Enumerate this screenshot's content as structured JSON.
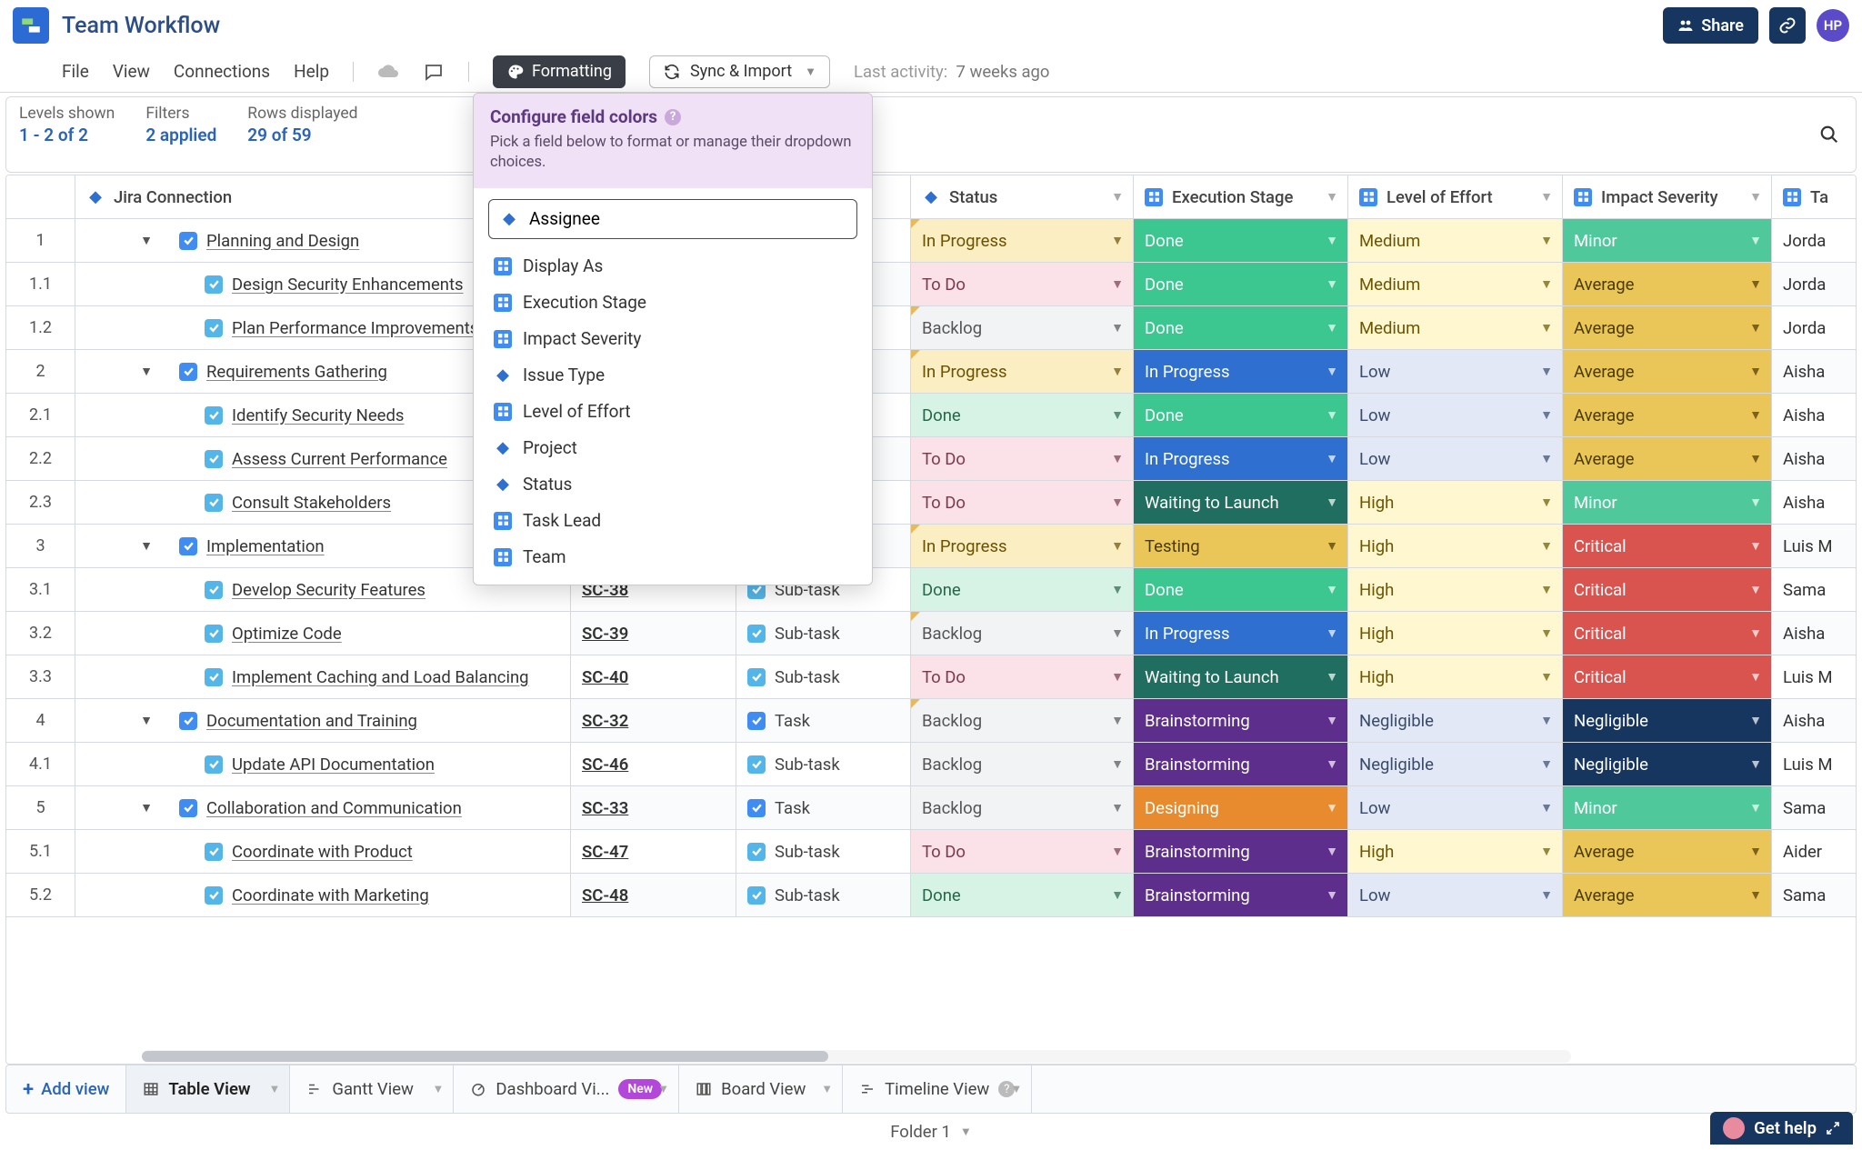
{
  "header": {
    "title": "Team Workflow",
    "share": "Share",
    "avatar": "HP"
  },
  "menubar": {
    "file": "File",
    "view": "View",
    "connections": "Connections",
    "help": "Help",
    "formatting": "Formatting",
    "sync": "Sync & Import",
    "activity_label": "Last activity:",
    "activity_value": "7 weeks ago"
  },
  "panel": {
    "levels_label": "Levels shown",
    "levels_value": "1 - 2 of 2",
    "filters_label": "Filters",
    "filters_value": "2 applied",
    "rows_label": "Rows displayed",
    "rows_value": "29 of 59"
  },
  "dropdown": {
    "title": "Configure field colors",
    "help": "Pick a field below to format or manage their dropdown choices.",
    "search": "Assignee",
    "items": [
      {
        "icon": "board",
        "label": "Display As"
      },
      {
        "icon": "board",
        "label": "Execution Stage"
      },
      {
        "icon": "board",
        "label": "Impact Severity"
      },
      {
        "icon": "diamond",
        "label": "Issue Type"
      },
      {
        "icon": "board",
        "label": "Level of Effort"
      },
      {
        "icon": "diamond",
        "label": "Project"
      },
      {
        "icon": "diamond",
        "label": "Status"
      },
      {
        "icon": "board",
        "label": "Task Lead"
      },
      {
        "icon": "board",
        "label": "Team"
      }
    ]
  },
  "columns": [
    {
      "key": "num",
      "label": "",
      "icon": "",
      "w": "w-num"
    },
    {
      "key": "name",
      "label": "Jira Connection",
      "icon": "jira",
      "w": "w-name"
    },
    {
      "key": "id",
      "label": "",
      "icon": "",
      "w": "w-id"
    },
    {
      "key": "type",
      "label": "",
      "icon": "",
      "w": "w-type"
    },
    {
      "key": "status",
      "label": "Status",
      "icon": "diamond",
      "w": "w-status",
      "caret": true
    },
    {
      "key": "stage",
      "label": "Execution Stage",
      "icon": "board",
      "w": "w-stage",
      "caret": true
    },
    {
      "key": "effort",
      "label": "Level of Effort",
      "icon": "board",
      "w": "w-effort",
      "caret": true
    },
    {
      "key": "impact",
      "label": "Impact Severity",
      "icon": "board",
      "w": "w-impact",
      "caret": true
    },
    {
      "key": "lead",
      "label": "Ta",
      "icon": "board",
      "w": "w-lead"
    }
  ],
  "status_colors": {
    "In Progress": "c-inprog-light",
    "To Do": "c-todo",
    "Backlog": "c-backlog",
    "Done": "c-done-light"
  },
  "stage_colors": {
    "Done": "c-done",
    "In Progress": "c-inprog",
    "Waiting to Launch": "c-waiting",
    "Testing": "c-testing",
    "Brainstorming": "c-brainstorm",
    "Designing": "c-designing"
  },
  "effort_colors": {
    "Medium": "c-med",
    "Low": "c-low",
    "High": "c-high",
    "Negligible": "c-negl"
  },
  "impact_colors": {
    "Minor": "c-minor",
    "Average": "c-average",
    "Critical": "c-critical",
    "Negligible": "c-negl-dark"
  },
  "rows": [
    {
      "num": "1",
      "depth": 0,
      "expand": true,
      "chk": "task",
      "name": "Planning and Design",
      "id": "",
      "type": "",
      "status": "In Progress",
      "stage": "Done",
      "effort": "Medium",
      "impact": "Minor",
      "lead": "Jorda",
      "corner": true
    },
    {
      "num": "1.1",
      "depth": 1,
      "chk": "sub",
      "name": "Design Security Enhancements",
      "id": "",
      "type": "",
      "status": "To Do",
      "stage": "Done",
      "effort": "Medium",
      "impact": "Average",
      "lead": "Jorda"
    },
    {
      "num": "1.2",
      "depth": 1,
      "chk": "sub",
      "name": "Plan Performance Improvements",
      "id": "",
      "type": "",
      "status": "Backlog",
      "stage": "Done",
      "effort": "Medium",
      "impact": "Average",
      "lead": "Jorda",
      "corner": true
    },
    {
      "num": "2",
      "depth": 0,
      "expand": true,
      "chk": "task",
      "name": "Requirements Gathering",
      "id": "",
      "type": "",
      "status": "In Progress",
      "stage": "In Progress",
      "effort": "Low",
      "impact": "Average",
      "lead": "Aisha",
      "corner": true
    },
    {
      "num": "2.1",
      "depth": 1,
      "chk": "sub",
      "name": "Identify Security Needs",
      "id": "",
      "type": "",
      "status": "Done",
      "stage": "Done",
      "effort": "Low",
      "impact": "Average",
      "lead": "Aisha"
    },
    {
      "num": "2.2",
      "depth": 1,
      "chk": "sub",
      "name": "Assess Current Performance",
      "id": "",
      "type": "",
      "status": "To Do",
      "stage": "In Progress",
      "effort": "Low",
      "impact": "Average",
      "lead": "Aisha"
    },
    {
      "num": "2.3",
      "depth": 1,
      "chk": "sub",
      "name": "Consult Stakeholders",
      "id": "",
      "type": "",
      "status": "To Do",
      "stage": "Waiting to Launch",
      "effort": "High",
      "impact": "Minor",
      "lead": "Aisha"
    },
    {
      "num": "3",
      "depth": 0,
      "expand": true,
      "chk": "task",
      "name": "Implementation",
      "id": "",
      "type": "",
      "status": "In Progress",
      "stage": "Testing",
      "effort": "High",
      "impact": "Critical",
      "lead": "Luis M",
      "corner": true
    },
    {
      "num": "3.1",
      "depth": 1,
      "chk": "sub",
      "name": "Develop Security Features",
      "id": "SC-38",
      "type": "Sub-task",
      "status": "Done",
      "stage": "Done",
      "effort": "High",
      "impact": "Critical",
      "lead": "Sama"
    },
    {
      "num": "3.2",
      "depth": 1,
      "chk": "sub",
      "name": "Optimize Code",
      "id": "SC-39",
      "type": "Sub-task",
      "status": "Backlog",
      "stage": "In Progress",
      "effort": "High",
      "impact": "Critical",
      "lead": "Aisha",
      "corner": true
    },
    {
      "num": "3.3",
      "depth": 1,
      "chk": "sub",
      "name": "Implement Caching and Load Balancing",
      "id": "SC-40",
      "type": "Sub-task",
      "status": "To Do",
      "stage": "Waiting to Launch",
      "effort": "High",
      "impact": "Critical",
      "lead": "Luis M"
    },
    {
      "num": "4",
      "depth": 0,
      "expand": true,
      "chk": "task",
      "name": "Documentation and Training",
      "id": "SC-32",
      "type": "Task",
      "status": "Backlog",
      "stage": "Brainstorming",
      "effort": "Negligible",
      "impact": "Negligible",
      "lead": "Aisha",
      "corner": true
    },
    {
      "num": "4.1",
      "depth": 1,
      "chk": "sub",
      "name": "Update API Documentation",
      "id": "SC-46",
      "type": "Sub-task",
      "status": "Backlog",
      "stage": "Brainstorming",
      "effort": "Negligible",
      "impact": "Negligible",
      "lead": "Luis M"
    },
    {
      "num": "5",
      "depth": 0,
      "expand": true,
      "chk": "task",
      "name": "Collaboration and Communication",
      "id": "SC-33",
      "type": "Task",
      "status": "Backlog",
      "stage": "Designing",
      "effort": "Low",
      "impact": "Minor",
      "lead": "Sama"
    },
    {
      "num": "5.1",
      "depth": 1,
      "chk": "sub",
      "name": "Coordinate with Product",
      "id": "SC-47",
      "type": "Sub-task",
      "status": "To Do",
      "stage": "Brainstorming",
      "effort": "High",
      "impact": "Average",
      "lead": "Aider"
    },
    {
      "num": "5.2",
      "depth": 1,
      "chk": "sub",
      "name": "Coordinate with Marketing",
      "id": "SC-48",
      "type": "Sub-task",
      "status": "Done",
      "stage": "Brainstorming",
      "effort": "Low",
      "impact": "Average",
      "lead": "Sama"
    }
  ],
  "viewtabs": {
    "add": "Add view",
    "new": "New",
    "tabs": [
      {
        "icon": "table",
        "label": "Table View",
        "active": true
      },
      {
        "icon": "gantt",
        "label": "Gantt View"
      },
      {
        "icon": "dash",
        "label": "Dashboard Vi...",
        "badge": true
      },
      {
        "icon": "board",
        "label": "Board View"
      },
      {
        "icon": "timeline",
        "label": "Timeline View",
        "help": true
      }
    ]
  },
  "footer": {
    "folder": "Folder 1"
  },
  "gethelp": "Get help"
}
